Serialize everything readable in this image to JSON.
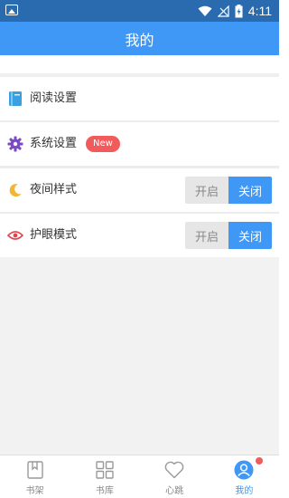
{
  "status_bar": {
    "time": "4:11"
  },
  "header": {
    "title": "我的"
  },
  "settings": {
    "reading": {
      "label": "阅读设置",
      "icon": "book-icon"
    },
    "system": {
      "label": "系统设置",
      "icon": "gear-icon",
      "badge": "New"
    },
    "night": {
      "label": "夜间样式",
      "icon": "moon-icon",
      "on_label": "开启",
      "off_label": "关闭",
      "state": "关闭"
    },
    "eye": {
      "label": "护眼模式",
      "icon": "eye-icon",
      "on_label": "开启",
      "off_label": "关闭",
      "state": "关闭"
    }
  },
  "bottom_nav": {
    "items": [
      {
        "label": "书架",
        "icon": "bookshelf-icon"
      },
      {
        "label": "书库",
        "icon": "library-grid-icon"
      },
      {
        "label": "心跳",
        "icon": "heart-icon"
      },
      {
        "label": "我的",
        "icon": "user-icon",
        "active": true,
        "has_notification_dot": true
      }
    ]
  },
  "colors": {
    "accent": "#3f98f5",
    "status_bar": "#2a6bb0",
    "badge": "#f25b5b"
  }
}
